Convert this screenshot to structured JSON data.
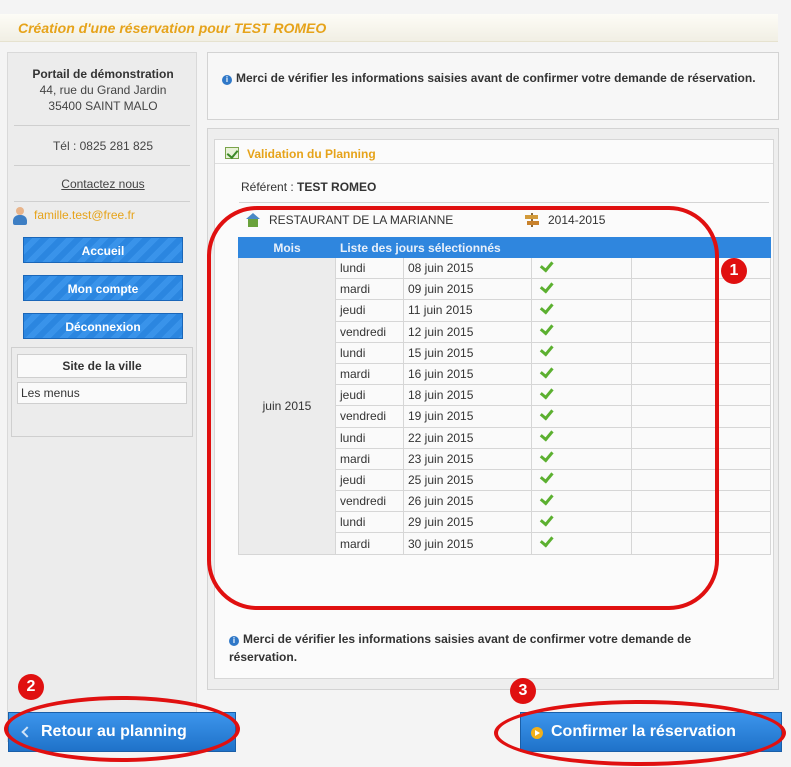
{
  "page": {
    "title": "Création d'une réservation pour TEST ROMEO"
  },
  "sidebar": {
    "org_name": "Portail de démonstration",
    "address_line1": "44, rue du Grand Jardin",
    "address_line2": "35400 SAINT MALO",
    "tel": "Tél : 0825 281 825",
    "contact_label": "Contactez nous",
    "user_email": "famille.test@free.fr",
    "nav": [
      {
        "label": "Accueil"
      },
      {
        "label": "Mon compte"
      },
      {
        "label": "Déconnexion"
      }
    ],
    "city_title": "Site de la ville",
    "city_link": "Les menus"
  },
  "main": {
    "info_top": "Merci de vérifier les informations saisies avant de confirmer votre demande de réservation.",
    "panel_title": "Validation du Planning",
    "referent_label": "Référent :",
    "referent_name": "TEST ROMEO",
    "restaurant": "RESTAURANT DE LA MARIANNE",
    "year": "2014-2015",
    "table": {
      "col_month": "Mois",
      "col_days": "Liste des jours sélectionnés",
      "month": "juin 2015",
      "rows": [
        {
          "day": "lundi",
          "date": "08 juin 2015"
        },
        {
          "day": "mardi",
          "date": "09 juin 2015"
        },
        {
          "day": "jeudi",
          "date": "11 juin 2015"
        },
        {
          "day": "vendredi",
          "date": "12 juin 2015"
        },
        {
          "day": "lundi",
          "date": "15 juin 2015"
        },
        {
          "day": "mardi",
          "date": "16 juin 2015"
        },
        {
          "day": "jeudi",
          "date": "18 juin 2015"
        },
        {
          "day": "vendredi",
          "date": "19 juin 2015"
        },
        {
          "day": "lundi",
          "date": "22 juin 2015"
        },
        {
          "day": "mardi",
          "date": "23 juin 2015"
        },
        {
          "day": "jeudi",
          "date": "25 juin 2015"
        },
        {
          "day": "vendredi",
          "date": "26 juin 2015"
        },
        {
          "day": "lundi",
          "date": "29 juin 2015"
        },
        {
          "day": "mardi",
          "date": "30 juin 2015"
        }
      ]
    },
    "info_bottom": "Merci de vérifier les informations saisies avant de confirmer votre demande de réservation."
  },
  "buttons": {
    "back": "Retour au planning",
    "confirm": "Confirmer la réservation"
  },
  "annotations": {
    "b1": "1",
    "b2": "2",
    "b3": "3"
  },
  "colors": {
    "accent": "#e6a31a",
    "button_blue": "#2f86de",
    "annotation_red": "#e01010",
    "check_green": "#5cb030"
  }
}
